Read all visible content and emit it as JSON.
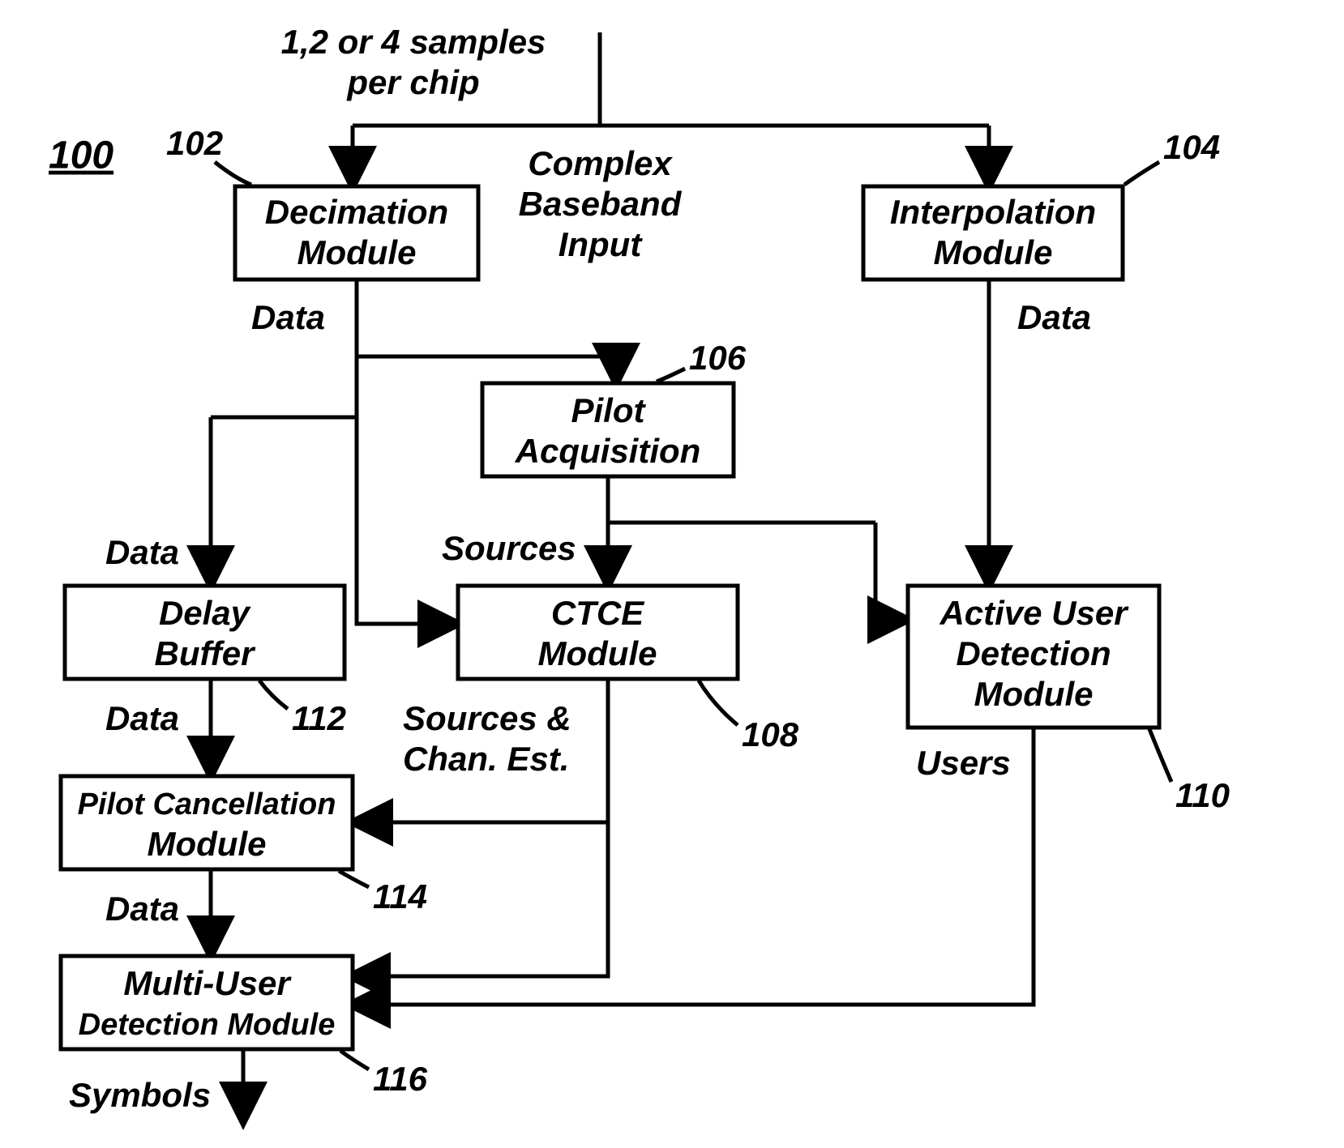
{
  "figure_number": "100",
  "topLabel": {
    "line1": "1,2 or 4 samples",
    "line2": "per chip"
  },
  "centerLabel": {
    "line1": "Complex",
    "line2": "Baseband",
    "line3": "Input"
  },
  "boxes": {
    "decimation": {
      "ref": "102",
      "line1": "Decimation",
      "line2": "Module",
      "out": "Data"
    },
    "interpolation": {
      "ref": "104",
      "line1": "Interpolation",
      "line2": "Module",
      "out": "Data"
    },
    "pilotAcq": {
      "ref": "106",
      "line1": "Pilot",
      "line2": "Acquisition",
      "out": "Sources"
    },
    "ctce": {
      "ref": "108",
      "line1": "CTCE",
      "line2": "Module",
      "out1": "Sources &",
      "out2": "Chan. Est."
    },
    "activeUser": {
      "ref": "110",
      "line1": "Active User",
      "line2": "Detection",
      "line3": "Module",
      "out": "Users"
    },
    "delayBuffer": {
      "ref": "112",
      "line1": "Delay",
      "line2": "Buffer",
      "in": "Data",
      "out": "Data"
    },
    "pilotCancel": {
      "ref": "114",
      "line1": "Pilot Cancellation",
      "line2": "Module",
      "out": "Data"
    },
    "multiUser": {
      "ref": "116",
      "line1": "Multi-User",
      "line2": "Detection Module",
      "out": "Symbols"
    }
  }
}
